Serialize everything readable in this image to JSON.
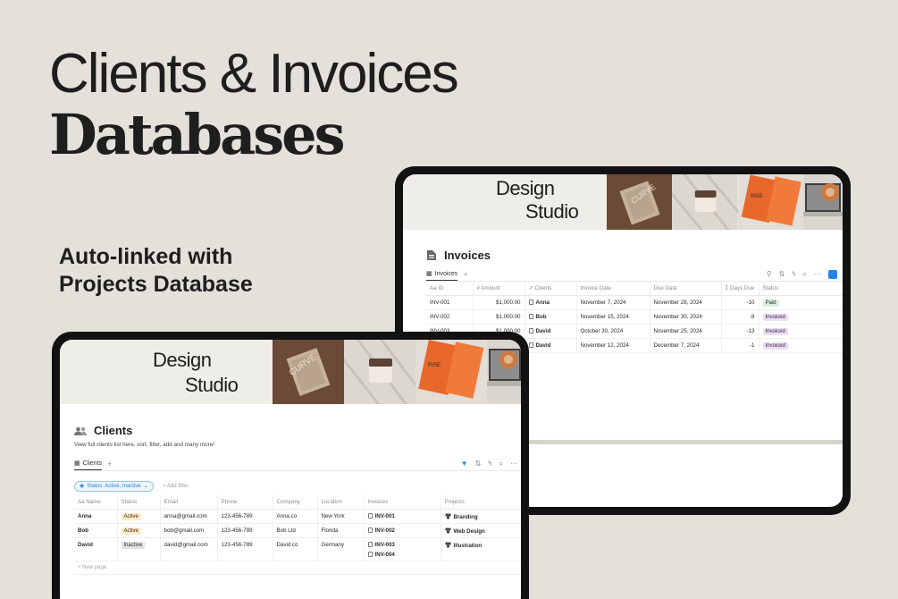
{
  "hero": {
    "title_line1": "Clients & Invoices",
    "title_line2": "Databases",
    "subtitle_line1": "Auto-linked with",
    "subtitle_line2": "Projects Database"
  },
  "brand": {
    "line1": "Design",
    "line2": "Studio"
  },
  "banner_tiles": {
    "card_text": "CURVE",
    "book_text": "RISE"
  },
  "invoices": {
    "title": "Invoices",
    "view_tab": "Invoices",
    "columns": [
      "Aa ID",
      "# Amount",
      "↗ Clients",
      "Invoice Date",
      "Due Date",
      "Σ Days Due",
      "Status"
    ],
    "rows": [
      {
        "id": "INV-001",
        "amount": "$1,000.00",
        "client": "Anna",
        "invoice_date": "November 7, 2024",
        "due_date": "November 28, 2024",
        "days_due": "-10",
        "status": "Paid"
      },
      {
        "id": "INV-002",
        "amount": "$1,000.00",
        "client": "Bob",
        "invoice_date": "November 15, 2024",
        "due_date": "November 30, 2024",
        "days_due": "-8",
        "status": "Invoiced"
      },
      {
        "id": "INV-003",
        "amount": "$1,000.00",
        "client": "David",
        "invoice_date": "October 30, 2024",
        "due_date": "November 25, 2024",
        "days_due": "-13",
        "status": "Invoiced"
      },
      {
        "id": "INV-004",
        "amount": "$1,000.00",
        "client": "David",
        "invoice_date": "November 12, 2024",
        "due_date": "December 7, 2024",
        "days_due": "-1",
        "status": "Invoiced"
      }
    ]
  },
  "clients": {
    "title": "Clients",
    "description": "View full clients list here, sort, filter, add and many more!",
    "view_tab": "Clients",
    "filter_label": "Status: Active, Inactive",
    "add_filter": "+ Add filter",
    "new_page": "+ New page",
    "columns": [
      "Aa Name",
      "Status",
      "Email",
      "Phone",
      "Company",
      "Location",
      "Invoices",
      "Projects"
    ],
    "rows": [
      {
        "name": "Anna",
        "status": "Active",
        "email": "anna@gmail.com",
        "phone": "123-456-789",
        "company": "Anna.co",
        "location": "New York",
        "invoices": [
          "INV-001"
        ],
        "projects": [
          "Branding"
        ]
      },
      {
        "name": "Bob",
        "status": "Active",
        "email": "bob@gmail.com",
        "phone": "123-456-789",
        "company": "Bob Ltd",
        "location": "Florida",
        "invoices": [
          "INV-002"
        ],
        "projects": [
          "Web Design"
        ]
      },
      {
        "name": "David",
        "status": "Inactive",
        "email": "david@gmail.com",
        "phone": "123-456-789",
        "company": "David.co",
        "location": "Germany",
        "invoices": [
          "INV-003",
          "INV-004"
        ],
        "projects": [
          "Illustration"
        ]
      }
    ]
  },
  "colors": {
    "background": "#e4e0da",
    "paid": "#dbeddb",
    "invoiced": "#e8deee",
    "active": "#fdecc8",
    "inactive": "#e3e2e0",
    "accent": "#2383e2"
  }
}
